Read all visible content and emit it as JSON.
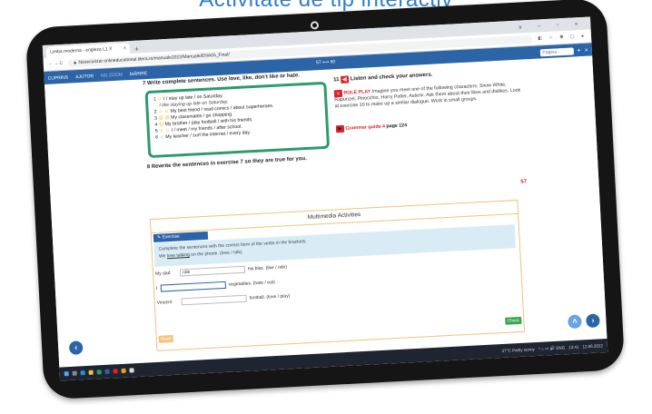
{
  "headline": "Activitate de tip interactiv",
  "browser": {
    "tab_title": "Limba moderna - engleza L1 X",
    "tab_close": "×",
    "new_tab": "+",
    "window_controls": "v – ▫ ×",
    "nav": "← → C",
    "security": "▲ Nesecurizat",
    "url": "onlineducational.litera.ro/manuale2022/Manuale/ENA05_Final/",
    "addr_icons": "◧ ☆ ✽ ▢ ●"
  },
  "app_toolbar": {
    "cuprins": "CUPRINS",
    "ajutor": "AJUTOR",
    "no_zoom": "NO ZOOM",
    "marire": "MĂRIRE",
    "page_indicator": "57 ⟷ 60",
    "page_placeholder": "Pagina...",
    "gear": "✦",
    "close": "✕"
  },
  "exercise7": {
    "label": "7  Write complete sentences. Use love, like, don't like or hate.",
    "items": [
      {
        "n": "1",
        "face": "☺",
        "text": "I / stay up late / on Saturday."
      },
      {
        "n": "",
        "face": "",
        "text": "I like staying up late on Saturday."
      },
      {
        "n": "2",
        "face": "☺ ☺",
        "text": "My best friend / read comics / about superheroes."
      },
      {
        "n": "3",
        "face": "☹ ☹",
        "text": "My classmates / go shopping."
      },
      {
        "n": "4",
        "face": "☹",
        "text": "My brother / play football / with his friends."
      },
      {
        "n": "5",
        "face": "☺ ☺",
        "text": "I / meet / my friends / after school."
      },
      {
        "n": "6",
        "face": "☺",
        "text": "My teacher / surf the internet / every day."
      }
    ]
  },
  "exercise8": {
    "label": "8  Rewrite the sentences in exercise 7 so they are true for you."
  },
  "exercise11": {
    "num": "11",
    "audio": "◀)",
    "label": "Listen and check your answers."
  },
  "roleplay": {
    "title": "ROLE PLAY",
    "text": "Imagine you meet one of the following characters: Snow White, Rapunzel, Pinocchio, Harry Potter, Asterix. Ask them about their likes and dislikes. Look at exercise 10 to make up a similar dialogue. Work in small groups."
  },
  "grammar": {
    "label": "Grammar guide 4",
    "page": "page 124"
  },
  "page_number": "57",
  "multimedia": {
    "title": "Multimedia Activities",
    "exercise_tab": "✎ Exercise",
    "instruction": "Complete the sentences with the correct form of the verbs in the brackets.",
    "example_prefix": "We",
    "example_answer": "love talking",
    "example_suffix": "on the phone. (love / talk)",
    "questions": [
      {
        "subject": "My dad",
        "answer": "ride",
        "rest": "his bike. (like / ride)"
      },
      {
        "subject": "I",
        "answer": "",
        "rest": "vegetables. (hate / eat)"
      },
      {
        "subject": "Vincent",
        "answer": "",
        "rest": "football. (love / play)"
      }
    ],
    "reset": "Reset",
    "check": "Check"
  },
  "taskbar": {
    "weather": "27°C  Partly sunny",
    "tray": "^ ⌂ ▭ 🔊 ENG",
    "time": "13:41",
    "date": "12.06.2022"
  },
  "nav_buttons": {
    "back": "‹",
    "up": "˄",
    "next": "›"
  }
}
